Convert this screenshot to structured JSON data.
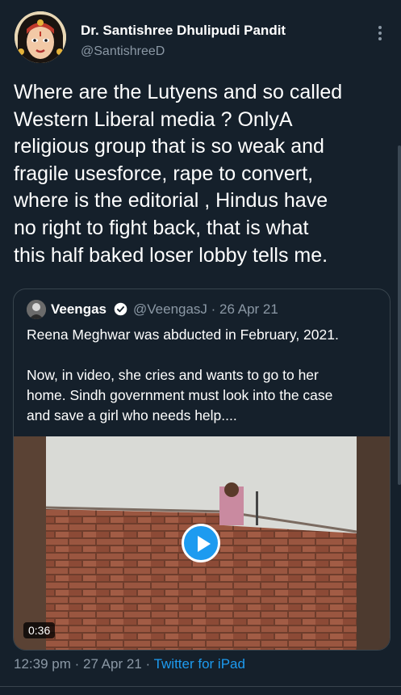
{
  "author": {
    "name": "Dr. Santishree Dhulipudi Pandit",
    "handle": "@SantishreeD",
    "avatar_icon": "goddess-portrait-avatar"
  },
  "tweet": {
    "text": "Where are the Lutyens and so called\nWestern Liberal media ? OnlyA\nreligious group  that is so weak and\nfragile usesforce, rape to convert,\nwhere is the editorial , Hindus have\nno right to fight back, that is what\nthis half baked loser lobby tells me."
  },
  "quoted_tweet": {
    "name": "Veengas",
    "handle_date": "@VeengasJ · 26 Apr 21",
    "text": "Reena Meghwar was abducted in February, 2021.\n\nNow, in video, she cries and wants to go to her\nhome. Sindh government must look into the case\nand save a girl who needs help....",
    "video": {
      "duration": "0:36"
    }
  },
  "meta": {
    "time_date": "12:39 pm · 27 Apr 21 · ",
    "source": "Twitter for iPad"
  },
  "colors": {
    "background": "#15202b",
    "accent": "#1d9bf0",
    "secondary_text": "#8b98a5",
    "border": "#38444d"
  }
}
